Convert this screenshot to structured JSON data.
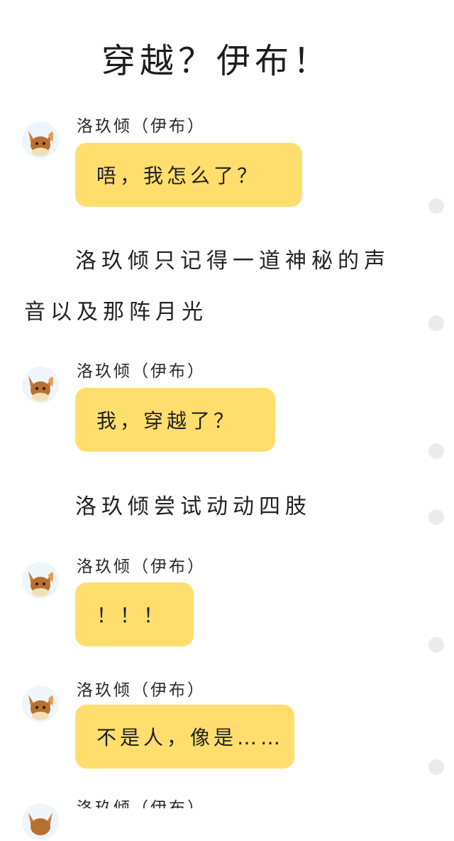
{
  "title": "穿越？伊布！",
  "sender_name": "洛玖倾（伊布）",
  "messages": [
    {
      "sender": "洛玖倾（伊布）",
      "text": "唔，我怎么了？"
    },
    {
      "sender": "洛玖倾（伊布）",
      "text": "我，穿越了？"
    },
    {
      "sender": "洛玖倾（伊布）",
      "text": "！！！"
    },
    {
      "sender": "洛玖倾（伊布）",
      "text": "不是人，像是……"
    },
    {
      "sender": "洛玖倾（伊布）",
      "text": ""
    }
  ],
  "narration": [
    {
      "line1": "洛玖倾只记得一道神秘的声",
      "line2": "音以及那阵月光"
    },
    {
      "line1": "洛玖倾尝试动动四肢"
    }
  ],
  "colors": {
    "bubble": "#ffde6e",
    "background": "#ffffff",
    "dot": "#ebebeb"
  },
  "icons": {
    "avatar": "eevee-avatar-icon",
    "dot": "comment-dot-icon"
  }
}
